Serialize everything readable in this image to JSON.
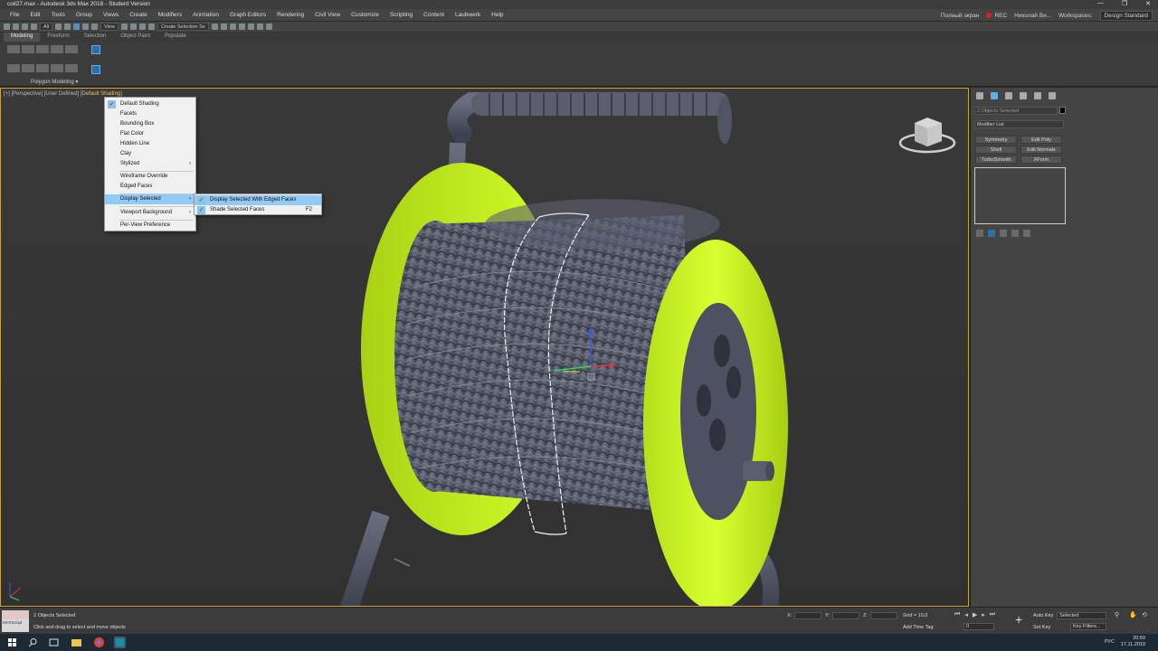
{
  "window": {
    "title": "coil27.max - Autodesk 3ds Max 2018 - Student Version",
    "controls": [
      "—",
      "❐",
      "✕"
    ]
  },
  "menu": {
    "items": [
      "File",
      "Edit",
      "Tools",
      "Group",
      "Views",
      "Create",
      "Modifiers",
      "Animation",
      "Graph Editors",
      "Rendering",
      "Civil View",
      "Customize",
      "Scripting",
      "Content",
      "Laubwerk",
      "Help"
    ],
    "fullscreen": "Полный экран",
    "rec": "REC",
    "user": "Николай Ви...",
    "workspaces_label": "Workspaces:",
    "workspace": "Design Standard"
  },
  "toolbar": {
    "filter": "All",
    "view": "View",
    "selection_set": "Create Selection Se"
  },
  "ribbon": {
    "tabs": [
      "Modeling",
      "Freeform",
      "Selection",
      "Object Paint",
      "Populate"
    ],
    "group_label": "Polygon Modeling ▾"
  },
  "viewport": {
    "label_prefix": "[+] [Perspective] [User Defined] [",
    "label_shading": "Default Shading",
    "label_suffix": "]"
  },
  "context_menu": {
    "items": {
      "default_shading": "Default Shading",
      "facets": "Facets",
      "bounding_box": "Bounding Box",
      "flat_color": "Flat Color",
      "hidden_line": "Hidden Line",
      "clay": "Clay",
      "stylized": "Stylized",
      "wireframe_override": "Wireframe Override",
      "edged_faces": "Edged Faces",
      "display_selected": "Display Selected",
      "viewport_background": "Viewport Background",
      "per_view_preference": "Per-View Preference"
    },
    "submenu": {
      "edged_faces": "Display Selected With Edged Faces",
      "shade_selected": "Shade Selected Faces",
      "shade_shortcut": "F2"
    }
  },
  "command_panel": {
    "name_field": "2 Objects Selected",
    "modifier_list": "Modifier List",
    "modifiers": [
      "Symmetry",
      "Edit Poly",
      "Shell",
      "Edit Normals",
      "TurboSmooth",
      "XForm"
    ]
  },
  "status": {
    "maxscript": "MAXScript",
    "selection": "2 Objects Selected",
    "prompt": "Click and drag to select and move objects",
    "x_label": "X:",
    "y_label": "Y:",
    "z_label": "Z:",
    "grid": "Grid = 10,0",
    "time_tag": "Add Time Tag",
    "autokey": "Auto Key",
    "setkey": "Set Key",
    "key_mode": "Selected",
    "key_filters": "Key Filters...",
    "frame": "0"
  },
  "taskbar": {
    "lang": "РУС",
    "time": "20:50",
    "date": "17.11.2019"
  },
  "colors": {
    "spool_flange": "#c6f81a",
    "cable": "#5b5f6e",
    "selection_border": "#c8a23c",
    "menu_highlight": "#91c9f7"
  }
}
